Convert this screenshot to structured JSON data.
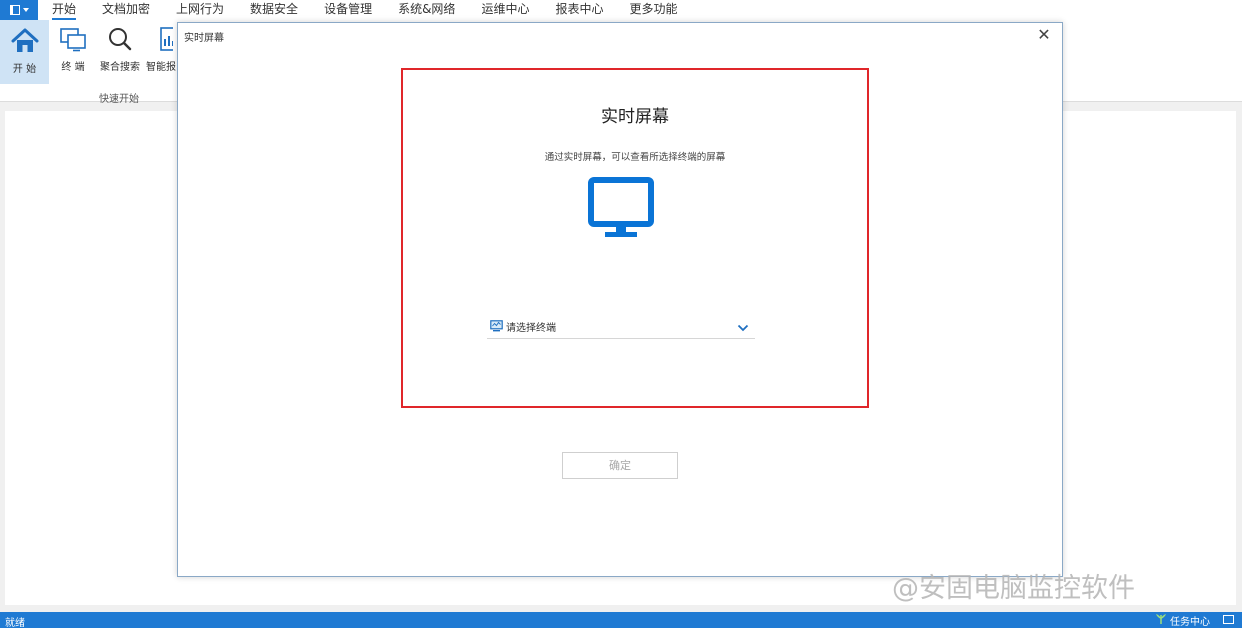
{
  "menubar": {
    "tabs": [
      {
        "label": "开始"
      },
      {
        "label": "文档加密"
      },
      {
        "label": "上网行为"
      },
      {
        "label": "数据安全"
      },
      {
        "label": "设备管理"
      },
      {
        "label": "系统&网络"
      },
      {
        "label": "运维中心"
      },
      {
        "label": "报表中心"
      },
      {
        "label": "更多功能"
      }
    ],
    "active_tab": "开始"
  },
  "ribbon": {
    "buttons": [
      {
        "label": "开 始",
        "icon": "home-icon"
      },
      {
        "label": "终 端",
        "icon": "terminal-icon"
      },
      {
        "label": "聚合搜索",
        "icon": "search-icon"
      },
      {
        "label": "智能报",
        "icon": "report-icon"
      }
    ],
    "group_label": "快速开始"
  },
  "dialog": {
    "title": "实时屏幕",
    "panel_title": "实时屏幕",
    "description": "通过实时屏幕，可以查看所选择终端的屏幕",
    "select_placeholder": "请选择终端",
    "confirm_label": "确定"
  },
  "statusbar": {
    "status": "就绪",
    "task_center": "任务中心"
  },
  "watermark": "@安固电脑监控软件",
  "colors": {
    "accent": "#1f7ad3",
    "highlight": "#e0262a",
    "monitor": "#0a74d6"
  }
}
